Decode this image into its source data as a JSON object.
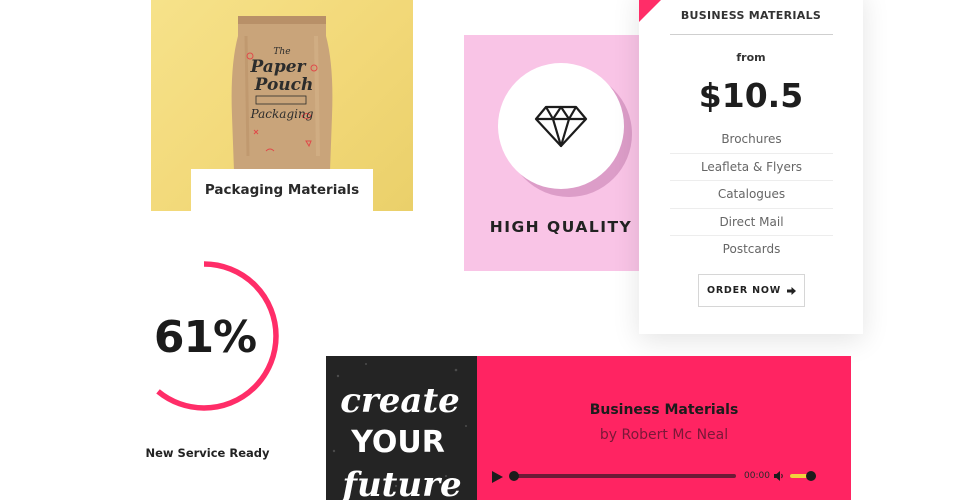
{
  "packaging_card": {
    "label": "Packaging Materials",
    "image": "paper-pouch-image",
    "pouch_text": [
      "The",
      "Paper",
      "Pouch",
      "Packaging"
    ]
  },
  "quality_card": {
    "icon": "diamond-icon",
    "title": "HIGH QUALITY"
  },
  "pricing_card": {
    "title": "BUSINESS MATERIALS",
    "from_label": "from",
    "price": "$10.5",
    "features": [
      "Brochures",
      "Leafleta & Flyers",
      "Catalogues",
      "Direct Mail",
      "Postcards"
    ],
    "order_button": "ORDER NOW",
    "order_icon": "arrow-right-icon"
  },
  "progress": {
    "value_text": "61%",
    "percent": 61,
    "label": "New Service Ready"
  },
  "audio_player": {
    "artwork_lines": [
      "create",
      "YOUR",
      "future"
    ],
    "title": "Business Materials",
    "author": "by Robert Mc Neal",
    "time": "00:00",
    "play_icon": "play-icon",
    "volume_icon": "volume-icon",
    "playback_progress": 0,
    "volume_level": 0.8
  },
  "colors": {
    "accent": "#ff2462",
    "pink_card": "#f9c4e6",
    "yellow_bg": "#f2d878",
    "dark": "#242424",
    "volume_fill": "#f3d23e"
  }
}
